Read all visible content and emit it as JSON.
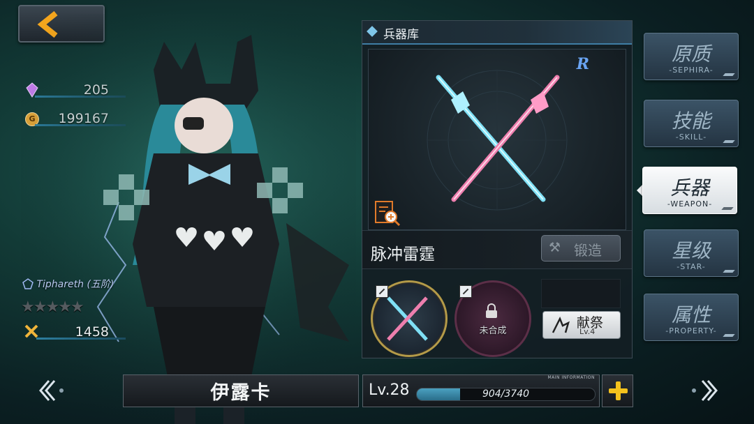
{
  "currency": {
    "crystal": "205",
    "gold": "199167",
    "gold_icon_label": "G"
  },
  "character": {
    "rank": "Tiphareth",
    "rank_tier": "(五阶)",
    "stars_total": 5,
    "stars_filled": 0,
    "power": "1458",
    "name": "伊露卡",
    "level": "Lv.28",
    "exp_text": "904/3740",
    "exp_current": 904,
    "exp_max": 3740,
    "main_info_label": "MAIN INFORMATION"
  },
  "weapon_panel": {
    "title": "兵器库",
    "rarity": "R",
    "weapon_name": "脉冲雷霆",
    "forge_label": "锻造",
    "slot2_label": "未合成",
    "offer_label": "献祭",
    "offer_level": "Lv.4"
  },
  "tabs": [
    {
      "cn": "原质",
      "en": "-SEPHIRA-"
    },
    {
      "cn": "技能",
      "en": "-SKILL-"
    },
    {
      "cn": "兵器",
      "en": "-WEAPON-"
    },
    {
      "cn": "星级",
      "en": "-STAR-"
    },
    {
      "cn": "属性",
      "en": "-PROPERTY-"
    }
  ],
  "active_tab": "兵器",
  "colors": {
    "accent_gold": "#f4c21d",
    "exp_blue": "#4aa0c0",
    "rarity_blue": "#6aa4f2"
  }
}
